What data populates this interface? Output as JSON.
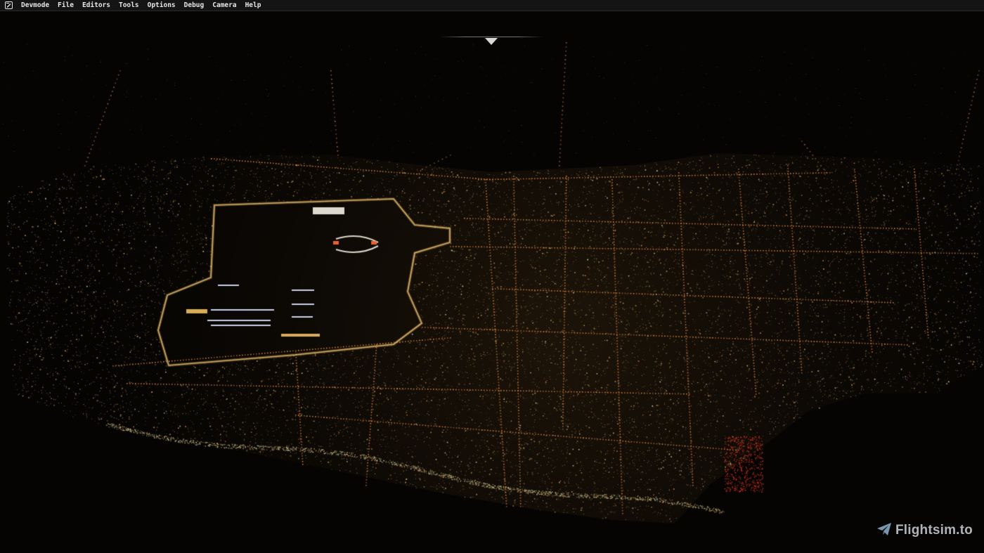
{
  "app": {
    "menu": [
      {
        "id": "devmode",
        "label": "Devmode"
      },
      {
        "id": "file",
        "label": "File"
      },
      {
        "id": "editors",
        "label": "Editors"
      },
      {
        "id": "tools",
        "label": "Tools"
      },
      {
        "id": "options",
        "label": "Options"
      },
      {
        "id": "debug",
        "label": "Debug"
      },
      {
        "id": "camera",
        "label": "Camera"
      },
      {
        "id": "help",
        "label": "Help"
      }
    ],
    "menu_icon": "devmode-icon"
  },
  "hud": {
    "heading_marker_icon": "heading-caret-icon"
  },
  "watermark": {
    "icon": "paper-plane-icon",
    "text": "Flightsim.to"
  },
  "scene": {
    "description_icon": "night-city-aerial",
    "colors": {
      "sky": "#050403",
      "light_warm": "#f2a24a",
      "light_yellow": "#e8d9a0",
      "light_white": "#f4f1e6",
      "light_red": "#d8351c"
    }
  }
}
